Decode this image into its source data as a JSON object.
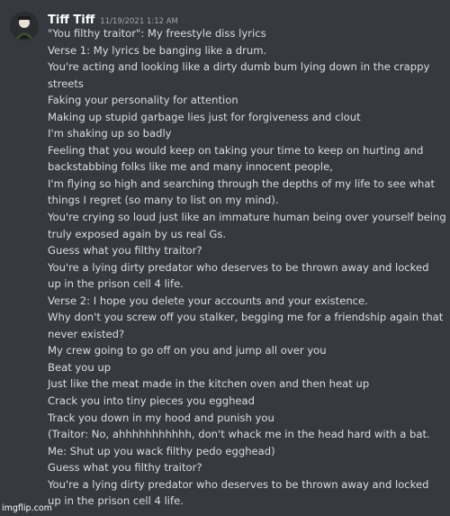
{
  "message": {
    "username": "Tiff Tiff",
    "timestamp": "11/19/2021 1:12 AM",
    "lines": [
      "\"You filthy traitor\": My freestyle diss lyrics",
      "Verse 1: My lyrics be banging like a drum.",
      "You're acting and looking like a dirty dumb bum lying down in the crappy",
      "streets",
      "Faking your personality for attention",
      "Making up stupid garbage lies just for forgiveness and clout",
      "I'm shaking up so badly",
      "Feeling that you would keep on taking your time to keep on hurting and",
      "backstabbing folks like me and many innocent people,",
      "I'm flying so high and searching through the depths of my life to see what",
      "things I regret (so many to list on my mind).",
      "You're crying so loud just like an immature human being over yourself being",
      "truly exposed again by us real Gs.",
      "Guess what you filthy traitor?",
      "You're a lying dirty predator who deserves to be thrown away and locked",
      "up in the prison cell 4 life.",
      "Verse 2: I hope you delete your accounts and your existence.",
      "Why don't you screw off you stalker, begging me for a friendship again that",
      "never existed?",
      "My crew going to go off on you and jump all over you",
      "Beat you up",
      "Just like the meat made in the kitchen oven and then heat up",
      "Crack you into tiny pieces you egghead",
      "Track you down in my hood and punish you",
      "(Traitor: No, ahhhhhhhhhhh, don't whack me in the head hard with a bat.",
      "Me: Shut up you wack filthy pedo egghead)",
      "Guess what you filthy traitor?",
      "You're a lying dirty predator who deserves to be thrown away and locked",
      "up in the prison cell 4 life."
    ]
  },
  "watermark": "imgflip.com",
  "colors": {
    "background": "#36393f",
    "username": "#ffffff",
    "timestamp": "#a3a6aa",
    "text": "#dcddde"
  }
}
